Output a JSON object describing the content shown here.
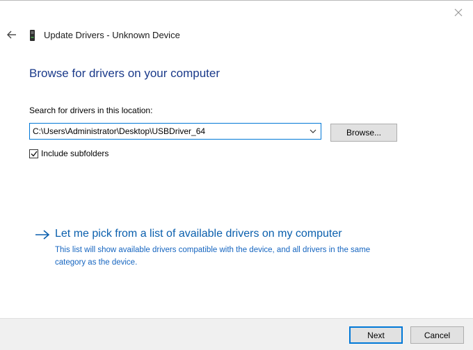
{
  "window": {
    "title": "Update Drivers - Unknown Device",
    "icons": {
      "close": "close-icon",
      "back": "back-arrow-icon",
      "device": "usb-device-icon"
    }
  },
  "main": {
    "heading": "Browse for drivers on your computer",
    "search_label": "Search for drivers in this location:",
    "path_value": "C:\\Users\\Administrator\\Desktop\\USBDriver_64",
    "browse_label": "Browse...",
    "include_subfolders_label": "Include subfolders",
    "include_subfolders_checked": true,
    "pick_link": "Let me pick from a list of available drivers on my computer",
    "pick_description": "This list will show available drivers compatible with the device, and all drivers in the same category as the device."
  },
  "footer": {
    "next_label": "Next",
    "cancel_label": "Cancel"
  },
  "colors": {
    "heading": "#1a3a8a",
    "link": "#0a5fad",
    "accent": "#0078d7",
    "footer_bg": "#f0f0f0"
  }
}
